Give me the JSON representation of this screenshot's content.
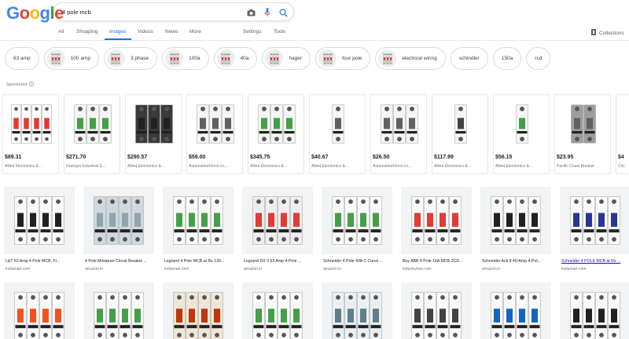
{
  "logo": {
    "letters": [
      "G",
      "o",
      "o",
      "g",
      "l",
      "e"
    ],
    "colors": [
      "#4285f4",
      "#ea4335",
      "#fbbc05",
      "#4285f4",
      "#34a853",
      "#ea4335"
    ]
  },
  "search": {
    "query": "4 pole mcb"
  },
  "tabs": [
    {
      "label": "All",
      "active": false
    },
    {
      "label": "Shopping",
      "active": false
    },
    {
      "label": "Images",
      "active": true
    },
    {
      "label": "Videos",
      "active": false
    },
    {
      "label": "News",
      "active": false
    },
    {
      "label": "More",
      "active": false
    },
    {
      "label": "Settings",
      "active": false
    },
    {
      "label": "Tools",
      "active": false
    }
  ],
  "collections_label": "Collections",
  "chips": [
    {
      "label": "63 amp",
      "thumb": false
    },
    {
      "label": "100 amp",
      "thumb": true
    },
    {
      "label": "3 phase",
      "thumb": true
    },
    {
      "label": "100a",
      "thumb": true
    },
    {
      "label": "40a",
      "thumb": true
    },
    {
      "label": "hager",
      "thumb": true
    },
    {
      "label": "four pole",
      "thumb": true
    },
    {
      "label": "electrical wiring",
      "thumb": true
    },
    {
      "label": "schindler",
      "thumb": false
    },
    {
      "label": "150a",
      "thumb": false
    },
    {
      "label": "rcd",
      "thumb": false
    }
  ],
  "sponsored_label": "Sponsored",
  "ads": [
    {
      "price": "$89.31",
      "merchant": "Allied Electronics &...",
      "poles": 4,
      "tint": "#ffffff",
      "accent": "#e53935"
    },
    {
      "price": "$271.70",
      "merchant": "Grainger Industrial S...",
      "poles": 3,
      "tint": "#f5f5f5",
      "accent": "#43a047"
    },
    {
      "price": "$290.57",
      "merchant": "Allied Electronics &...",
      "poles": 3,
      "tint": "#3a3a3a",
      "accent": "#212121"
    },
    {
      "price": "$59.00",
      "merchant": "AutomationDirect.co...",
      "poles": 3,
      "tint": "#f5f5f5",
      "accent": "#616161"
    },
    {
      "price": "$345.75",
      "merchant": "Allied Electronics &...",
      "poles": 3,
      "tint": "#f5f5f5",
      "accent": "#43a047"
    },
    {
      "price": "$40.67",
      "merchant": "Allied Electronics &...",
      "poles": 1,
      "tint": "#f5f5f5",
      "accent": "#616161"
    },
    {
      "price": "$26.50",
      "merchant": "AutomationDirect.co...",
      "poles": 3,
      "tint": "#f5f5f5",
      "accent": "#616161"
    },
    {
      "price": "$117.99",
      "merchant": "Allied Electronics &...",
      "poles": 1,
      "tint": "#f5f5f5",
      "accent": "#424242"
    },
    {
      "price": "$56.15",
      "merchant": "Allied Electronics &...",
      "poles": 1,
      "tint": "#f5f5f5",
      "accent": "#43a047"
    },
    {
      "price": "$23.95",
      "merchant": "Pacific Coast Breaker",
      "poles": 2,
      "tint": "#9e9e9e",
      "accent": "#616161"
    },
    {
      "price": "$4",
      "merchant": "Circ",
      "poles": 1,
      "tint": "#424242",
      "accent": "#212121"
    }
  ],
  "results_row1": [
    {
      "caption": "L&T 63 Amp 4 Pole MCB, Fr...",
      "source": "indiamart.com",
      "accent": "#212121",
      "body": "#fafafa",
      "linked": false
    },
    {
      "caption": "4 Pole Miniature Circuit Breaker ...",
      "source": "amazon.in",
      "accent": "#90a4ae",
      "body": "#cfd8dc",
      "linked": false
    },
    {
      "caption": "Legrand 4 Pole MCB at Rs 130...",
      "source": "indiamart.com",
      "accent": "#43a047",
      "body": "#fafafa",
      "linked": false
    },
    {
      "caption": "Legrand DX 3 63 Amp 4-Pole ...",
      "source": "amazon.in",
      "accent": "#e53935",
      "body": "#eeeeee",
      "linked": false
    },
    {
      "caption": "Schneider 4 Pole 40A C Curve ...",
      "source": "amazon.in",
      "accent": "#43a047",
      "body": "#fafafa",
      "linked": false
    },
    {
      "caption": "Buy ABB 4 Pole 16A MCB-2CD...",
      "source": "industrykart.com",
      "accent": "#e53935",
      "body": "#fafafa",
      "linked": false
    },
    {
      "caption": "Schneider Acti 9 40-Amp 4-Pol...",
      "source": "amazon.in",
      "accent": "#212121",
      "body": "#fafafa",
      "linked": false
    },
    {
      "caption": "Schneider 4 POLE MCB at Rs ...",
      "source": "indiamart.com",
      "accent": "#283593",
      "body": "#fafafa",
      "linked": true
    }
  ],
  "results_row2": [
    {
      "accent": "#f4511e",
      "body": "#fafafa"
    },
    {
      "accent": "#43a047",
      "body": "#fafafa"
    },
    {
      "accent": "#bf360c",
      "body": "#efe6d8"
    },
    {
      "accent": "#43a047",
      "body": "#fafafa"
    },
    {
      "accent": "#607d8b",
      "body": "#eceff1"
    },
    {
      "accent": "#424242",
      "body": "#fafafa"
    },
    {
      "accent": "#1565c0",
      "body": "#fafafa"
    },
    {
      "accent": "#212121",
      "body": "#fafafa"
    }
  ]
}
